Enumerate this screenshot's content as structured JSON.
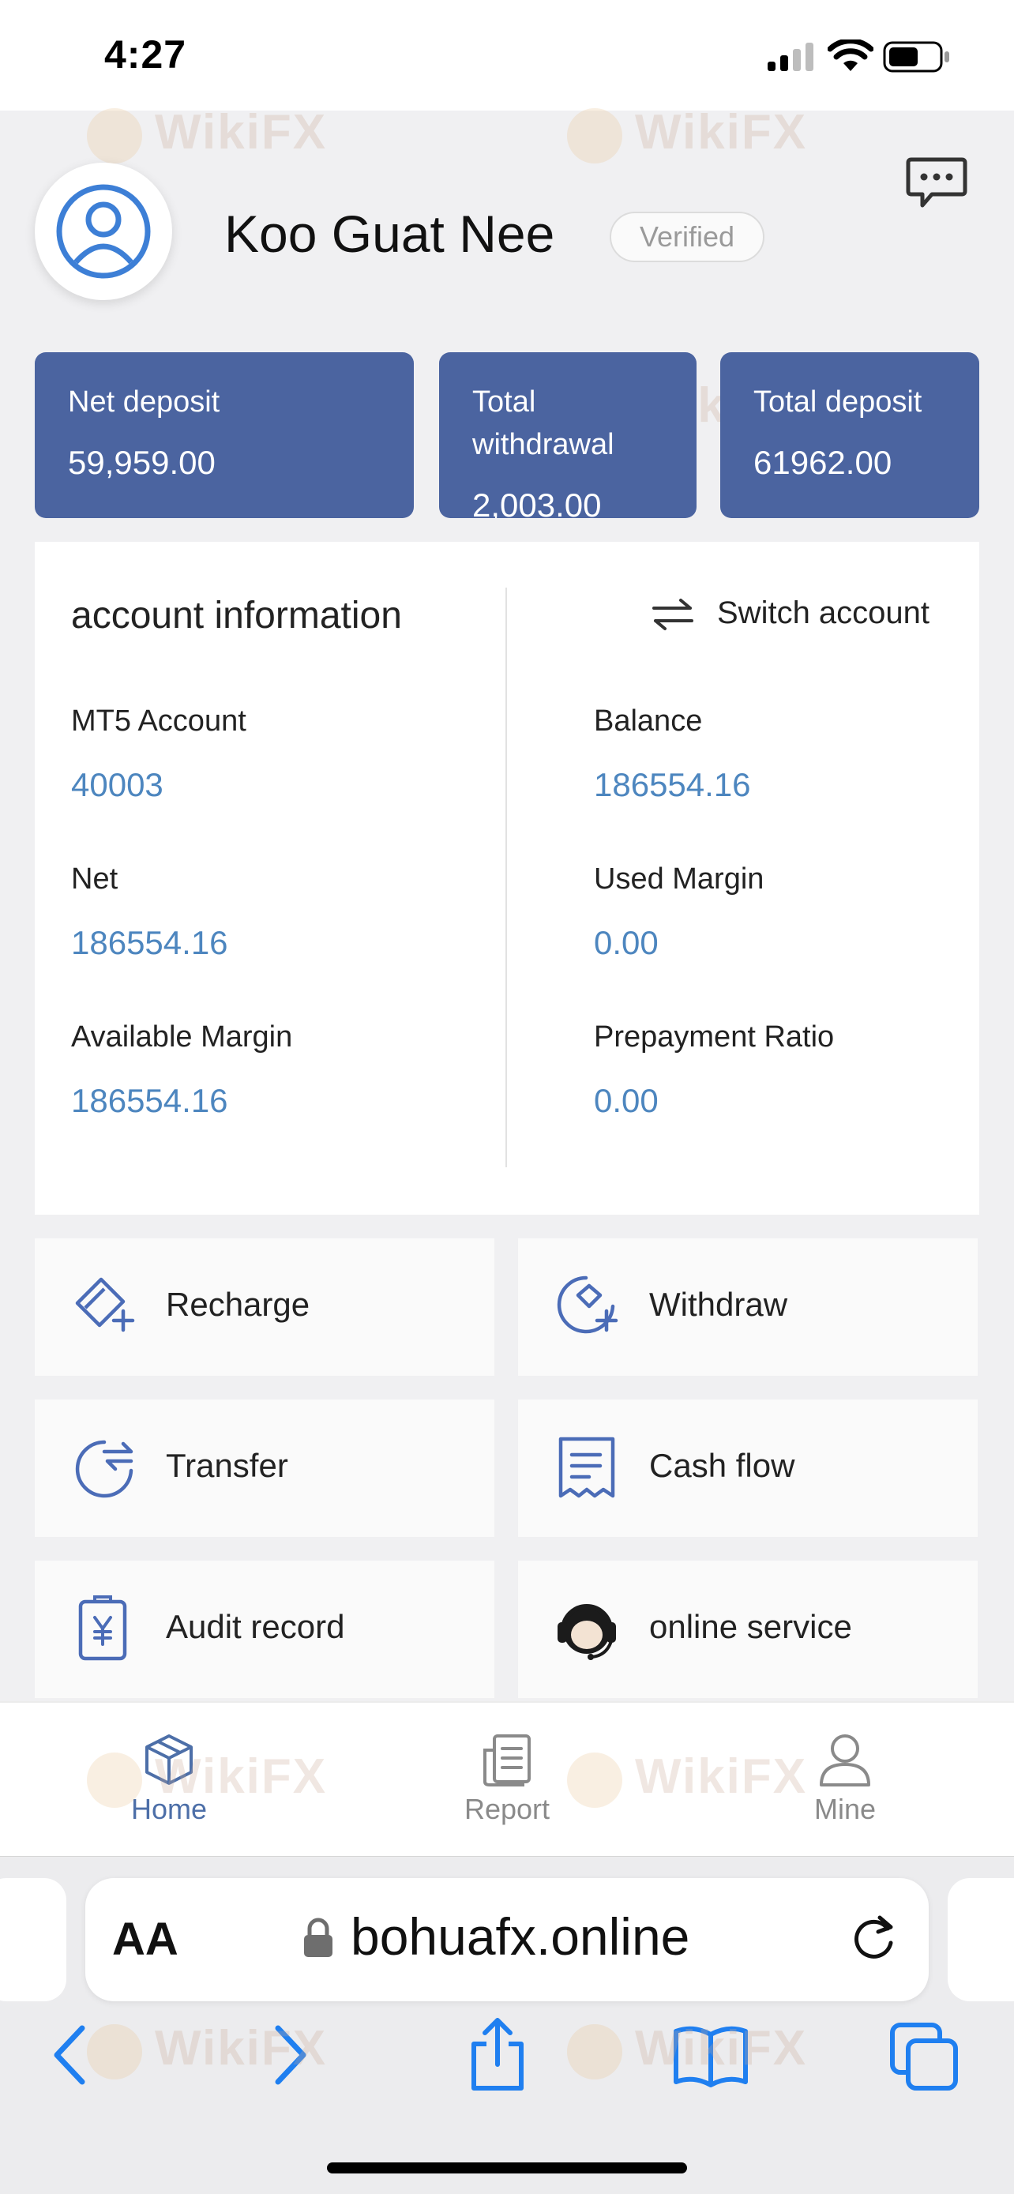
{
  "status_bar": {
    "time": "4:27"
  },
  "profile": {
    "name": "Koo Guat Nee",
    "badge": "Verified"
  },
  "stats": [
    {
      "label": "Net deposit",
      "value": "59,959.00"
    },
    {
      "label": "Total withdrawal",
      "value": "2,003.00"
    },
    {
      "label": "Total deposit",
      "value": "61962.00"
    }
  ],
  "account": {
    "title": "account information",
    "switch_label": "Switch account",
    "fields": [
      {
        "label": "MT5 Account",
        "value": "40003"
      },
      {
        "label": "Balance",
        "value": "186554.16"
      },
      {
        "label": "Net",
        "value": "186554.16"
      },
      {
        "label": "Used Margin",
        "value": "0.00"
      },
      {
        "label": "Available Margin",
        "value": "186554.16"
      },
      {
        "label": "Prepayment Ratio",
        "value": "0.00"
      }
    ]
  },
  "actions": [
    {
      "label": "Recharge",
      "icon": "recharge-icon"
    },
    {
      "label": "Withdraw",
      "icon": "withdraw-icon"
    },
    {
      "label": "Transfer",
      "icon": "transfer-icon"
    },
    {
      "label": "Cash flow",
      "icon": "cash-flow-icon"
    },
    {
      "label": "Audit record",
      "icon": "audit-record-icon"
    },
    {
      "label": "online service",
      "icon": "headset-icon"
    }
  ],
  "bottom_nav": [
    {
      "label": "Home",
      "icon": "cube-icon",
      "active": true
    },
    {
      "label": "Report",
      "icon": "report-icon",
      "active": false
    },
    {
      "label": "Mine",
      "icon": "person-icon",
      "active": false
    }
  ],
  "browser": {
    "aa_label": "AA",
    "url": "bohuafx.online"
  },
  "watermark": "WikiFX",
  "colors": {
    "accent": "#4b64a0",
    "value_blue": "#4d86bf",
    "ios_blue": "#1f7ff0",
    "nav_active": "#4d6fa8"
  }
}
